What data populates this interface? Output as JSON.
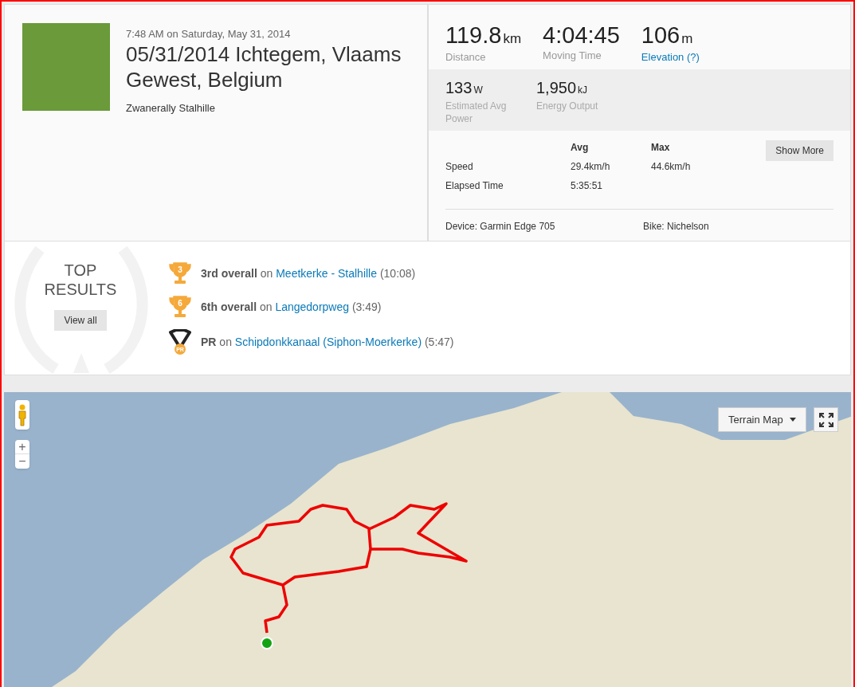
{
  "activity": {
    "datetime": "7:48 AM on Saturday, May 31, 2014",
    "title": "05/31/2014 Ichtegem, Vlaams Gewest, Belgium",
    "subtitle": "Zwanerally Stalhille"
  },
  "stats": [
    {
      "value": "119.8",
      "unit": "km",
      "label": "Distance",
      "kind": "plain"
    },
    {
      "value": "4:04:45",
      "label": "Moving Time",
      "kind": "plain"
    },
    {
      "value": "106",
      "unit": "m",
      "label": "Elevation (?)",
      "kind": "link"
    }
  ],
  "secondary_stats": [
    {
      "value": "133",
      "unit": "W",
      "label": "Estimated Avg Power"
    },
    {
      "value": "1,950",
      "unit": "kJ",
      "label": "Energy Output"
    }
  ],
  "splits": {
    "columns": [
      "Avg",
      "Max"
    ],
    "rows": [
      {
        "label": "Speed",
        "values": [
          "29.4km/h",
          "44.6km/h"
        ]
      },
      {
        "label": "Elapsed Time",
        "values": [
          "5:35:51"
        ]
      }
    ]
  },
  "show_more_button": "Show More",
  "device": "Device: Garmin Edge 705",
  "bike": "Bike: Nichelson",
  "top_results": {
    "title": "TOP RESULTS",
    "view_all_button": "View all",
    "results": [
      {
        "kind": "trophy",
        "badge": "3",
        "text": "**3rd overall** on ",
        "segment": "Meetkerke - Stalhille",
        "time": "(10:08)"
      },
      {
        "kind": "trophy",
        "badge": "6",
        "text": "**6th overall** on ",
        "segment": "Langedorpweg",
        "time": "(3:49)"
      },
      {
        "kind": "pr",
        "badge": "PR",
        "text": "**PR** on ",
        "segment": "Schipdonkkanaal (Siphon-Moerkerke)",
        "time": "(5:47)"
      }
    ]
  },
  "map": {
    "map_type_button": "Terrain Map",
    "zoom_in": "+",
    "zoom_out": "−"
  }
}
